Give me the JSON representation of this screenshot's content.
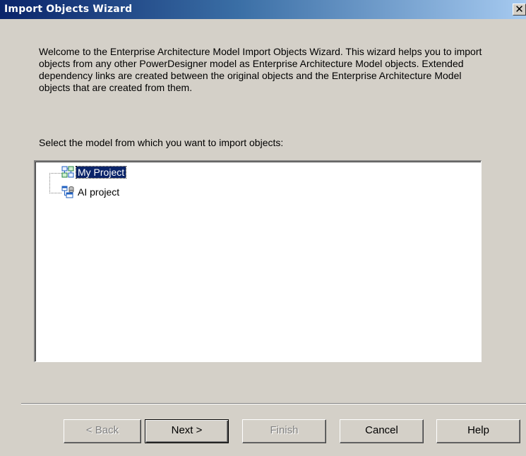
{
  "window": {
    "title": "Import Objects Wizard",
    "close_glyph": "✕"
  },
  "intro": {
    "text": "Welcome to the Enterprise Architecture Model Import Objects Wizard. This wizard helps you to import objects from any other PowerDesigner model as Enterprise Architecture Model objects. Extended dependency links are created between the original objects and the Enterprise Architecture Model objects that are created from them."
  },
  "select_label": "Select the model from which you want to import objects:",
  "tree": {
    "items": [
      {
        "label": "My Project",
        "icon": "project-model-icon",
        "selected": true
      },
      {
        "label": "AI project",
        "icon": "database-model-icon",
        "selected": false
      }
    ]
  },
  "buttons": {
    "back": "< Back",
    "next": "Next >",
    "finish": "Finish",
    "cancel": "Cancel",
    "help": "Help"
  },
  "colors": {
    "title_start": "#0a246a",
    "title_end": "#a6caf0",
    "face": "#d4d0c8",
    "selection": "#0a246a"
  }
}
